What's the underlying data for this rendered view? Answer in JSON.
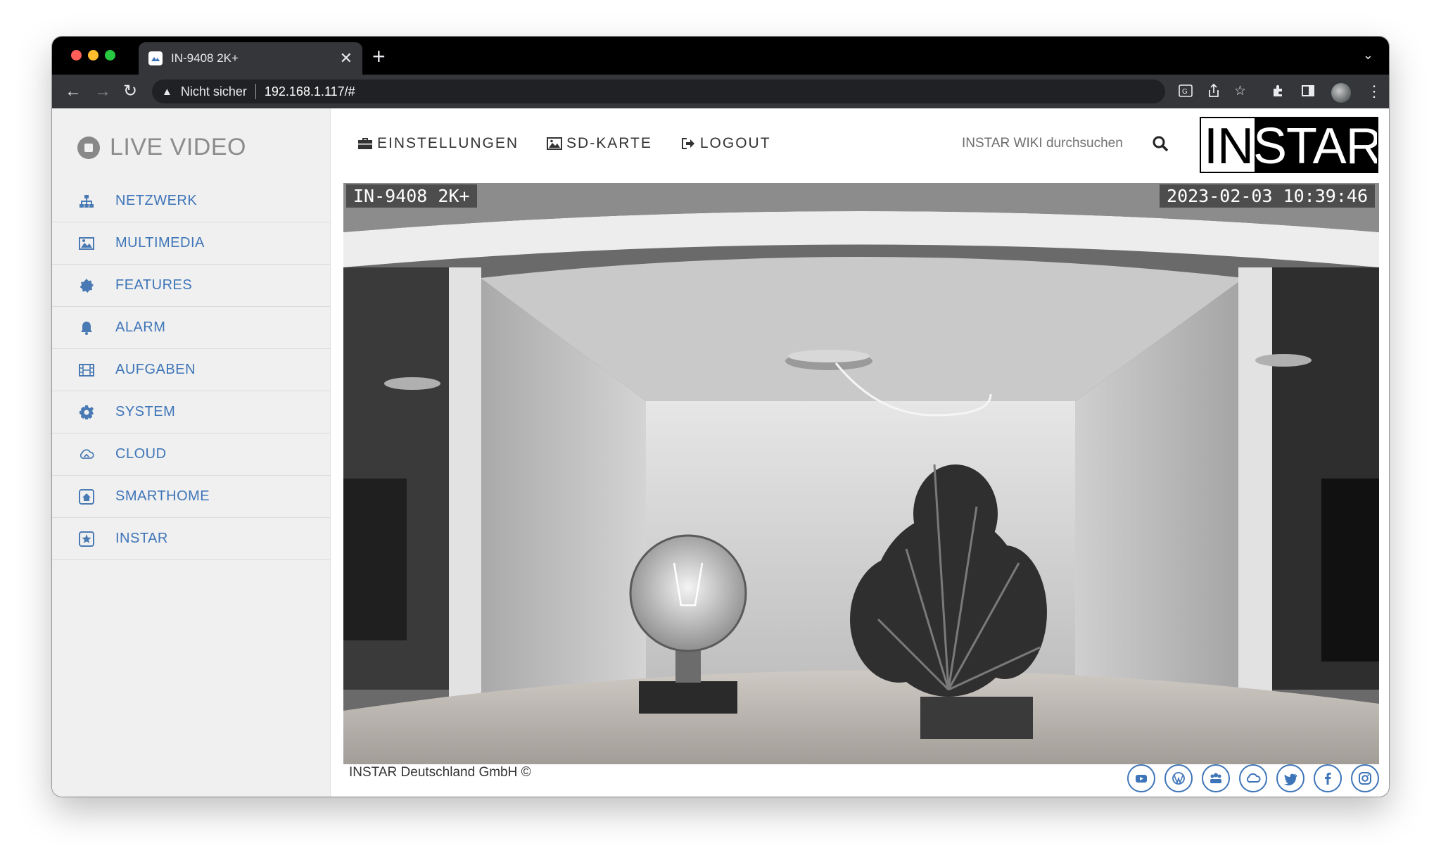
{
  "browser": {
    "tab_title": "IN-9408 2K+",
    "tab_close": "✕",
    "new_tab": "+",
    "security_label": "Nicht sicher",
    "url": "192.168.1.117/#"
  },
  "sidebar": {
    "title": "LIVE VIDEO",
    "items": [
      {
        "label": "NETZWERK",
        "icon": "network-icon"
      },
      {
        "label": "MULTIMEDIA",
        "icon": "image-icon"
      },
      {
        "label": "FEATURES",
        "icon": "badge-icon"
      },
      {
        "label": "ALARM",
        "icon": "bell-icon"
      },
      {
        "label": "AUFGABEN",
        "icon": "film-icon"
      },
      {
        "label": "SYSTEM",
        "icon": "gear-icon"
      },
      {
        "label": "CLOUD",
        "icon": "cloud-icon"
      },
      {
        "label": "SMARTHOME",
        "icon": "home-icon"
      },
      {
        "label": "INSTAR",
        "icon": "star-icon"
      }
    ]
  },
  "topnav": {
    "settings": "EINSTELLUNGEN",
    "sdcard": "SD-KARTE",
    "logout": "LOGOUT"
  },
  "search": {
    "placeholder": "INSTAR WIKI durchsuchen"
  },
  "logo": {
    "dark_part": "IN",
    "light_part": "STAR"
  },
  "video": {
    "camera_name": "IN-9408 2K+",
    "timestamp": "2023-02-03 10:39:46"
  },
  "footer": {
    "copyright": "INSTAR Deutschland GmbH ©",
    "social": [
      "youtube-icon",
      "wordpress-icon",
      "forum-icon",
      "cloud-icon",
      "twitter-icon",
      "facebook-icon",
      "instagram-icon"
    ]
  },
  "colors": {
    "accent": "#3e75b8",
    "sidebar_bg": "#f0f0f0",
    "chrome_dark": "#35363a"
  }
}
